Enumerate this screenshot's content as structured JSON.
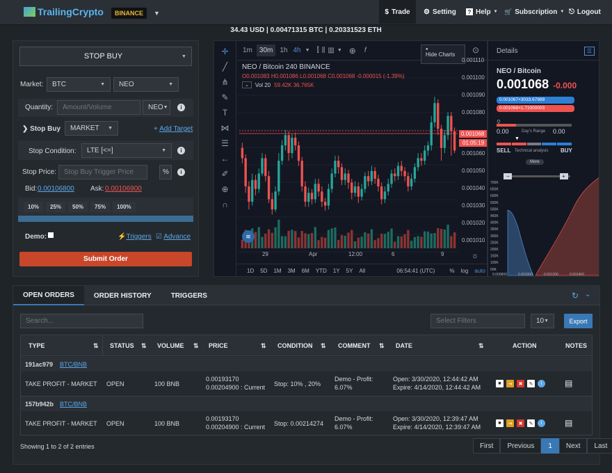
{
  "topbar": {
    "logo": "TrailingCrypto",
    "exchange": "BINANCE",
    "nav": [
      {
        "icon": "$",
        "label": "Trade"
      },
      {
        "icon": "⚙",
        "label": "Setting"
      },
      {
        "icon": "?",
        "label": "Help"
      },
      {
        "icon": "🛒",
        "label": "Subscription"
      },
      {
        "icon": "⎋",
        "label": "Logout"
      }
    ]
  },
  "balances": "34.43 USD  |  0.00471315 BTC  |  0.20331523 ETH",
  "order_form": {
    "order_type": "STOP BUY",
    "market_label": "Market:",
    "base": "BTC",
    "quote": "NEO",
    "quantity_label": "Quantity:",
    "quantity_placeholder": "Amount/Volume",
    "quantity_unit": "NEO",
    "stop_buy_label": "Stop Buy",
    "type_select": "MARKET",
    "add_target": "Add Target",
    "condition_label": "Stop Condition:",
    "condition_value": "LTE [<=]",
    "stop_price_label": "Stop Price:",
    "stop_price_placeholder": "Stop Buy Trigger Price",
    "percent": "%",
    "bid_label": "Bid:",
    "bid": "0.00106800",
    "ask_label": "Ask:",
    "ask": "0.00106900",
    "percents": [
      "10%",
      "25%",
      "50%",
      "75%",
      "100%"
    ],
    "demo_label": "Demo:",
    "triggers": "Triggers",
    "advance": "Advance",
    "submit": "Submit Order"
  },
  "chart": {
    "intervals": [
      "1m",
      "30m",
      "1h",
      "4h"
    ],
    "pair_title": "NEO / Bitcoin  240  BINANCE",
    "ohlc": "O0.001083 H0.001086 L0.001068 C0.001068 -0.000015 (-1.39%)",
    "vol_label": "Vol 20",
    "vol_value": "59.42K 36.765K",
    "hide_charts": "Hide Charts",
    "price_ticks": [
      "0.001110",
      "0.001100",
      "0.001090",
      "0.001080",
      "0.001068",
      "01:05:19",
      "0.001060",
      "0.001050",
      "0.001040",
      "0.001030",
      "0.001020",
      "0.001010"
    ],
    "date_ticks": [
      "29",
      "Apr",
      "12:00",
      "6",
      "9"
    ],
    "ranges": [
      "1D",
      "5D",
      "1M",
      "3M",
      "6M",
      "YTD",
      "1Y",
      "5Y",
      "All"
    ],
    "clock": "06:54:41 (UTC)",
    "scale_opts": [
      "%",
      "log",
      "auto"
    ],
    "candles": [
      [
        1070,
        1062,
        1074,
        1058
      ],
      [
        1062,
        1040,
        1065,
        1035
      ],
      [
        1040,
        1028,
        1044,
        1022
      ],
      [
        1028,
        1045,
        1050,
        1025
      ],
      [
        1045,
        1038,
        1049,
        1033
      ],
      [
        1038,
        1050,
        1054,
        1035
      ],
      [
        1050,
        1062,
        1066,
        1048
      ],
      [
        1062,
        1048,
        1065,
        1044
      ],
      [
        1048,
        1030,
        1052,
        1027
      ],
      [
        1030,
        1022,
        1035,
        1018
      ],
      [
        1022,
        1036,
        1040,
        1020
      ],
      [
        1036,
        1060,
        1066,
        1033
      ],
      [
        1060,
        1072,
        1076,
        1057
      ],
      [
        1072,
        1080,
        1084,
        1068
      ],
      [
        1080,
        1066,
        1083,
        1060
      ],
      [
        1066,
        1078,
        1081,
        1062
      ],
      [
        1078,
        1072,
        1082,
        1068
      ],
      [
        1072,
        1060,
        1075,
        1056
      ],
      [
        1060,
        1040,
        1063,
        1036
      ],
      [
        1040,
        1028,
        1044,
        1024
      ],
      [
        1028,
        1035,
        1039,
        1024
      ],
      [
        1035,
        1030,
        1038,
        1026
      ],
      [
        1030,
        1042,
        1046,
        1027
      ],
      [
        1042,
        1036,
        1046,
        1032
      ],
      [
        1036,
        1028,
        1040,
        1024
      ],
      [
        1028,
        1025,
        1031,
        1021
      ],
      [
        1025,
        1038,
        1042,
        1022
      ],
      [
        1038,
        1050,
        1054,
        1035
      ],
      [
        1050,
        1060,
        1064,
        1047
      ],
      [
        1060,
        1055,
        1064,
        1050
      ],
      [
        1055,
        1045,
        1058,
        1041
      ],
      [
        1045,
        1050,
        1054,
        1041
      ],
      [
        1050,
        1043,
        1053,
        1038
      ],
      [
        1043,
        1035,
        1046,
        1030
      ],
      [
        1035,
        1040,
        1044,
        1032
      ],
      [
        1040,
        1032,
        1043,
        1027
      ],
      [
        1032,
        1038,
        1042,
        1029
      ],
      [
        1038,
        1048,
        1051,
        1035
      ],
      [
        1048,
        1044,
        1052,
        1040
      ],
      [
        1044,
        1052,
        1056,
        1041
      ],
      [
        1052,
        1046,
        1055,
        1042
      ],
      [
        1046,
        1040,
        1049,
        1036
      ],
      [
        1040,
        1030,
        1043,
        1026
      ],
      [
        1030,
        1036,
        1040,
        1027
      ],
      [
        1036,
        1042,
        1046,
        1033
      ],
      [
        1042,
        1050,
        1053,
        1039
      ],
      [
        1050,
        1048,
        1054,
        1044
      ],
      [
        1048,
        1056,
        1059,
        1045
      ],
      [
        1056,
        1052,
        1060,
        1048
      ],
      [
        1052,
        1048,
        1055,
        1044
      ],
      [
        1048,
        1040,
        1051,
        1036
      ],
      [
        1040,
        1046,
        1050,
        1037
      ],
      [
        1046,
        1055,
        1058,
        1043
      ],
      [
        1055,
        1062,
        1066,
        1052
      ],
      [
        1062,
        1060,
        1066,
        1056
      ],
      [
        1060,
        1068,
        1072,
        1057
      ],
      [
        1068,
        1072,
        1075,
        1064
      ],
      [
        1072,
        1090,
        1095,
        1068
      ],
      [
        1090,
        1105,
        1110,
        1086
      ],
      [
        1105,
        1085,
        1108,
        1080
      ],
      [
        1085,
        1070,
        1088,
        1060
      ],
      [
        1070,
        1080,
        1084,
        1066
      ],
      [
        1080,
        1095,
        1098,
        1076
      ],
      [
        1095,
        1083,
        1098,
        1064
      ],
      [
        1083,
        1068,
        1086,
        1066
      ]
    ]
  },
  "details": {
    "title": "Details",
    "pair": "NEO / Bitcoin",
    "price_main": "0.0010",
    "price_tail": "68",
    "price_change": "-0.000",
    "bid_line": "0.001067×3033.67989",
    "ask_line": "0.001068×1.71000003",
    "range_low": "0.00",
    "range_high": "0.00",
    "range_label": "Day's Range",
    "sell": "SELL",
    "buy": "BUY",
    "tech_label": "Technical analysis",
    "more": "More",
    "depth_y": [
      "700K",
      "650K",
      "600K",
      "550K",
      "500K",
      "450K",
      "400K",
      "350K",
      "300K",
      "250K",
      "200K",
      "150K",
      "100K",
      "50K"
    ],
    "depth_x": [
      "0.000800",
      "0.001000",
      "0.001200",
      "0.001400"
    ]
  },
  "orders": {
    "tabs": [
      "OPEN ORDERS",
      "ORDER HISTORY",
      "TRIGGERS"
    ],
    "search_placeholder": "Search...",
    "filter_placeholder": "Select Filters",
    "page_size": "10",
    "export": "Export",
    "headers": [
      "TYPE",
      "STATUS",
      "VOLUME",
      "PRICE",
      "CONDITION",
      "COMMENT",
      "DATE",
      "ACTION",
      "NOTES"
    ],
    "groups": [
      {
        "id": "191ac979",
        "pair": "BTC/BNB",
        "type": "TAKE PROFIT - MARKET",
        "status": "OPEN",
        "volume": "100 BNB",
        "price1": "0.00193170",
        "price2": "0.00204900 : Current",
        "condition": "Stop: 10% , 20%",
        "comment1": "Demo - Profit:",
        "comment2": "6.07%",
        "date1": "Open: 3/30/2020, 12:44:42 AM",
        "date2": "Expire: 4/14/2020, 12:44:42 AM"
      },
      {
        "id": "157b942b",
        "pair": "BTC/BNB",
        "type": "TAKE PROFIT - MARKET",
        "status": "OPEN",
        "volume": "100 BNB",
        "price1": "0.00193170",
        "price2": "0.00204900 : Current",
        "condition": "Stop: 0.00214274",
        "comment1": "Demo - Profit:",
        "comment2": "6.07%",
        "date1": "Open: 3/30/2020, 12:39:47 AM",
        "date2": "Expire: 4/14/2020, 12:39:47 AM"
      }
    ],
    "showing": "Showing 1 to 2 of 2 entries",
    "pagination": [
      "First",
      "Previous",
      "1",
      "Next",
      "Last"
    ]
  },
  "colors": {
    "accent": "#5da8e8",
    "up": "#26a69a",
    "down": "#ef5350",
    "submit": "#c8462a",
    "export": "#3a78b5"
  }
}
